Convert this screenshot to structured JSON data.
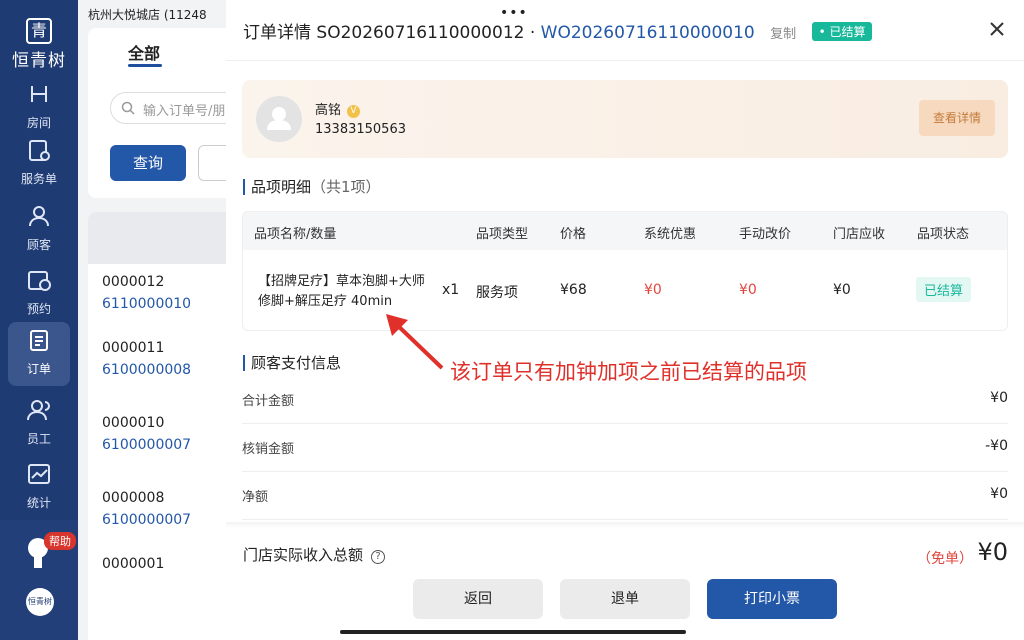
{
  "nav": {
    "logo_mark": "青",
    "logo_text": "恒青树",
    "items": [
      {
        "label": "房间"
      },
      {
        "label": "服务单"
      },
      {
        "label": "顾客"
      },
      {
        "label": "预约"
      },
      {
        "label": "订单"
      },
      {
        "label": "员工"
      },
      {
        "label": "统计"
      }
    ],
    "help_badge": "帮助",
    "footer_logo": "恒青树"
  },
  "background": {
    "store": "杭州大悦城店  (11248",
    "tab_all": "全部",
    "search_placeholder": "输入订单号/朋",
    "query_btn": "查询",
    "rows": [
      {
        "l1": "0000012",
        "l2": "6110000010"
      },
      {
        "l1": "0000011",
        "l2": "6100000008"
      },
      {
        "l1": "0000010",
        "l2": "6100000007"
      },
      {
        "l1": "0000008",
        "l2": "6100000007"
      },
      {
        "l1": "0000001",
        "l2": ""
      }
    ]
  },
  "drawer": {
    "drag_dots": "•••",
    "title_prefix": "订单详情",
    "so": "SO20260716110000012",
    "sep": "·",
    "wo": "WO20260716110000010",
    "copy": "复制",
    "status": "• 已结算",
    "customer": {
      "name": "高铭",
      "vip": "V",
      "phone": "13383150563",
      "detail_btn": "查看详情"
    },
    "items_section": {
      "title": "品项明细",
      "count": "（共1项）",
      "headers": [
        "品项名称/数量",
        "品项类型",
        "价格",
        "系统优惠",
        "手动改价",
        "门店应收",
        "品项状态"
      ],
      "row": {
        "name": "【招牌足疗】草本泡脚+大师修脚+解压足疗 40min",
        "qty": "x1",
        "type": "服务项",
        "price": "¥68",
        "sys_discount": "¥0",
        "manual": "¥0",
        "receivable": "¥0",
        "status": "已结算"
      }
    },
    "pay_section": {
      "title": "顾客支付信息",
      "rows": [
        {
          "label": "合计金额",
          "value": "¥0"
        },
        {
          "label": "核销金额",
          "value": "-¥0"
        },
        {
          "label": "净额",
          "value": "¥0"
        }
      ]
    },
    "total": {
      "label": "门店实际收入总额",
      "tag": "（免单）",
      "value": "¥0"
    },
    "buttons": {
      "back": "返回",
      "refund": "退单",
      "print": "打印小票"
    }
  },
  "annotation": "该订单只有加钟加项之前已结算的品项"
}
